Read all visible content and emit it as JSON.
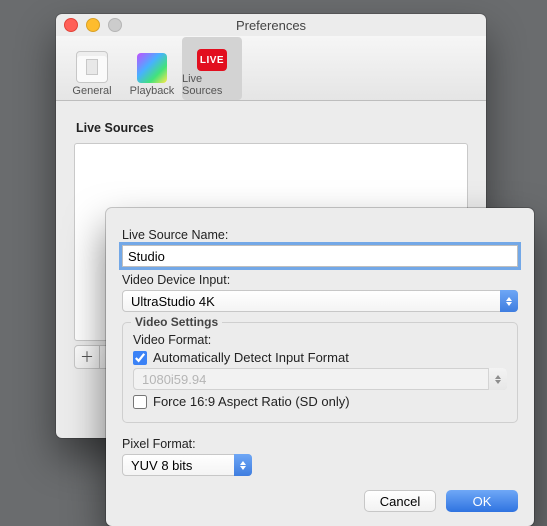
{
  "window": {
    "title": "Preferences"
  },
  "tabs": {
    "general": "General",
    "playback": "Playback",
    "live": "Live Sources"
  },
  "live_icon_text": "LIVE",
  "section": {
    "header": "Live Sources"
  },
  "sheet": {
    "name_label": "Live Source Name:",
    "name_value": "Studio",
    "device_label": "Video Device Input:",
    "device_value": "UltraStudio 4K",
    "settings_legend": "Video Settings",
    "format_label": "Video Format:",
    "auto_detect_label": "Automatically Detect Input Format",
    "auto_detect_checked": true,
    "format_value": "1080i59.94",
    "force_169_label": "Force 16:9 Aspect Ratio (SD only)",
    "force_169_checked": false,
    "pixel_label": "Pixel Format:",
    "pixel_value": "YUV 8 bits",
    "cancel": "Cancel",
    "ok": "OK"
  }
}
